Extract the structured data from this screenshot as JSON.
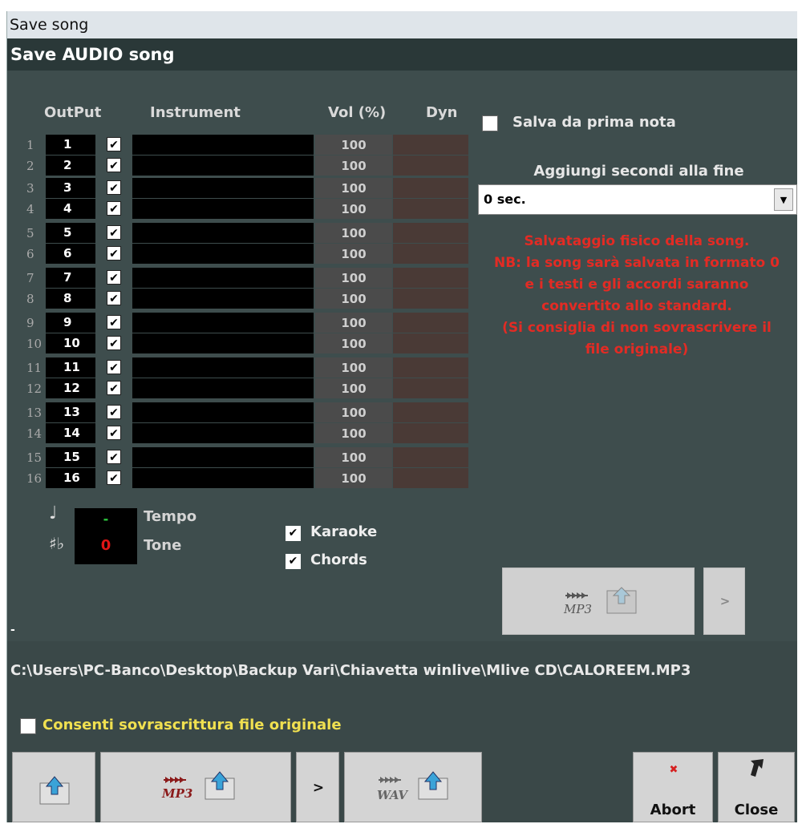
{
  "window": {
    "title": "Save song",
    "heading": "Save AUDIO song"
  },
  "table": {
    "headers": {
      "output": "OutPut",
      "instrument": "Instrument",
      "vol": "Vol (%)",
      "dyn": "Dyn"
    },
    "rows": [
      {
        "num": "1",
        "out": "1",
        "vol": "100"
      },
      {
        "num": "2",
        "out": "2",
        "vol": "100"
      },
      {
        "num": "3",
        "out": "3",
        "vol": "100"
      },
      {
        "num": "4",
        "out": "4",
        "vol": "100"
      },
      {
        "num": "5",
        "out": "5",
        "vol": "100"
      },
      {
        "num": "6",
        "out": "6",
        "vol": "100"
      },
      {
        "num": "7",
        "out": "7",
        "vol": "100"
      },
      {
        "num": "8",
        "out": "8",
        "vol": "100"
      },
      {
        "num": "9",
        "out": "9",
        "vol": "100"
      },
      {
        "num": "10",
        "out": "10",
        "vol": "100"
      },
      {
        "num": "11",
        "out": "11",
        "vol": "100"
      },
      {
        "num": "12",
        "out": "12",
        "vol": "100"
      },
      {
        "num": "13",
        "out": "13",
        "vol": "100"
      },
      {
        "num": "14",
        "out": "14",
        "vol": "100"
      },
      {
        "num": "15",
        "out": "15",
        "vol": "100"
      },
      {
        "num": "16",
        "out": "16",
        "vol": "100"
      }
    ],
    "check_glyph": "✔"
  },
  "options": {
    "salva_label": "Salva da prima nota",
    "aggiungi_label": "Aggiungi secondi alla fine",
    "aggiungi_value": "0 sec.",
    "notice": [
      "Salvataggio fisico della song.",
      "NB: la song sarà salvata in formato 0",
      "e i testi e gli accordi saranno",
      "convertito allo standard.",
      "(Si consiglia di non sovrascrivere il",
      "file originale)"
    ]
  },
  "tempo": {
    "tempo_label": "Tempo",
    "tone_label": "Tone",
    "tempo_value": "-",
    "tone_value": "0"
  },
  "toggles": {
    "karaoke_label": "Karaoke",
    "chords_label": "Chords"
  },
  "export": {
    "mp3_text": "MP3",
    "wav_text": "WAV",
    "next_label": ">"
  },
  "status": {
    "dash": "-"
  },
  "path": "C:\\Users\\PC-Banco\\Desktop\\Backup Vari\\Chiavetta winlive\\Mlive CD\\CALOREEM.MP3",
  "overwrite_label": "Consenti sovrascrittura file originale",
  "buttons": {
    "abort": "Abort",
    "close": "Close",
    "abort_mark": "✖"
  },
  "colors": {
    "notice": "#e32b24",
    "overwrite": "#f0e050",
    "tone": "#e01515",
    "tempo": "#2ecc40"
  }
}
